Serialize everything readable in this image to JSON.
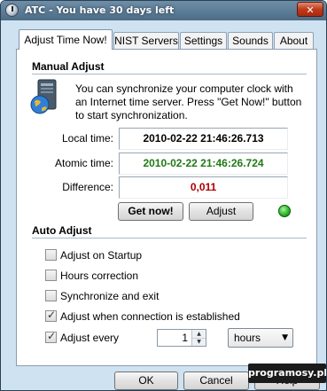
{
  "window": {
    "title": "ATC - You have 30 days left",
    "close_label": "✕"
  },
  "tabs": [
    {
      "label": "Adjust Time Now!",
      "active": true
    },
    {
      "label": "NIST Servers",
      "active": false
    },
    {
      "label": "Settings",
      "active": false
    },
    {
      "label": "Sounds",
      "active": false
    },
    {
      "label": "About",
      "active": false
    }
  ],
  "manual_adjust": {
    "title": "Manual Adjust",
    "intro": "You can synchronize your computer clock with an Internet time server. Press \"Get Now!\" button to start synchronization.",
    "local_time": {
      "label": "Local time:",
      "value": "2010-02-22 21:46:26.713",
      "color": "#000000"
    },
    "atomic_time": {
      "label": "Atomic time:",
      "value": "2010-02-22 21:46:26.724",
      "color": "#1f7a14"
    },
    "difference": {
      "label": "Difference:",
      "value": "0,011",
      "color": "#b00000"
    },
    "get_now_label": "Get now!",
    "adjust_label": "Adjust",
    "status_led": "green-status-icon"
  },
  "auto_adjust": {
    "title": "Auto Adjust",
    "options": [
      {
        "label": "Adjust on Startup",
        "checked": false
      },
      {
        "label": "Hours correction",
        "checked": false
      },
      {
        "label": "Synchronize and exit",
        "checked": false
      },
      {
        "label": "Adjust when connection is established",
        "checked": true
      },
      {
        "label": "Adjust every",
        "checked": true
      }
    ],
    "interval_value": "1",
    "interval_unit": "hours"
  },
  "footer": {
    "ok_label": "OK",
    "cancel_label": "Cancel",
    "help_label": "Help"
  },
  "watermark": "programosy.pl"
}
